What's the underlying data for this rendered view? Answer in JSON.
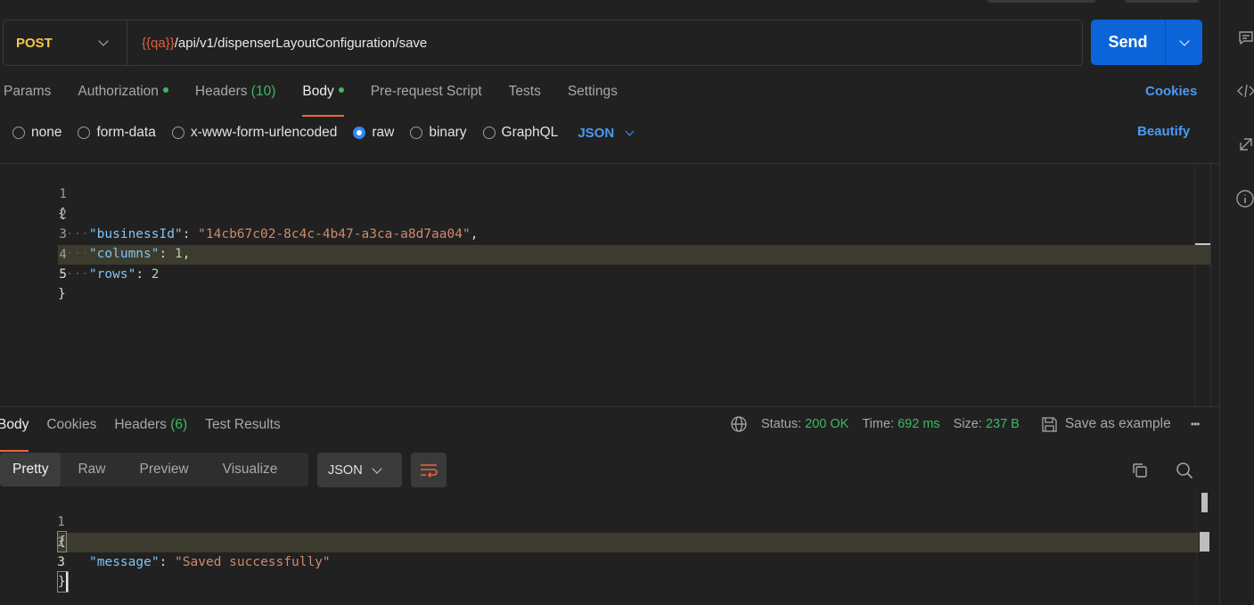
{
  "request": {
    "method": "POST",
    "url_variable": "{{qa}}",
    "url_path": "/api/v1/dispenserLayoutConfiguration/save",
    "send_label": "Send"
  },
  "request_tabs": [
    {
      "label": "Params",
      "active": false
    },
    {
      "label": "Authorization",
      "dot": true
    },
    {
      "label": "Headers",
      "count": "(10)"
    },
    {
      "label": "Body",
      "dot": true,
      "active": true
    },
    {
      "label": "Pre-request Script"
    },
    {
      "label": "Tests"
    },
    {
      "label": "Settings"
    }
  ],
  "cookies_link": "Cookies",
  "body_types": [
    "none",
    "form-data",
    "x-www-form-urlencoded",
    "raw",
    "binary",
    "GraphQL"
  ],
  "body_type_selected": "raw",
  "body_format": "JSON",
  "beautify_label": "Beautify",
  "request_body": {
    "line_numbers": [
      "1",
      "2",
      "3",
      "4",
      "5"
    ],
    "open_brace": "{",
    "close_brace": "}",
    "key1": "\"businessId\"",
    "val1": "\"14cb67c02-8c4c-4b47-a3ca-a8d7aa04\"",
    "key2": "\"columns\"",
    "val2": "1",
    "key3": "\"rows\"",
    "val3": "2"
  },
  "response_tabs": [
    {
      "label": "Body",
      "active": true
    },
    {
      "label": "Cookies"
    },
    {
      "label": "Headers",
      "count": "(6)"
    },
    {
      "label": "Test Results"
    }
  ],
  "status": {
    "status_label": "Status:",
    "status_value": "200 OK",
    "time_label": "Time:",
    "time_value": "692 ms",
    "size_label": "Size:",
    "size_value": "237 B",
    "save_example": "Save as example",
    "more": "•••"
  },
  "response_views": [
    "Pretty",
    "Raw",
    "Preview",
    "Visualize"
  ],
  "response_format": "JSON",
  "response_body": {
    "line_numbers": [
      "1",
      "2",
      "3"
    ],
    "open_brace": "{",
    "close_brace": "}",
    "key": "\"message\"",
    "value": "\"Saved successfully\""
  },
  "colors": {
    "accent": "#e8673c",
    "send": "#0b65d8",
    "link": "#4a9af4",
    "success": "#3cba63",
    "method": "#f2c94c"
  }
}
